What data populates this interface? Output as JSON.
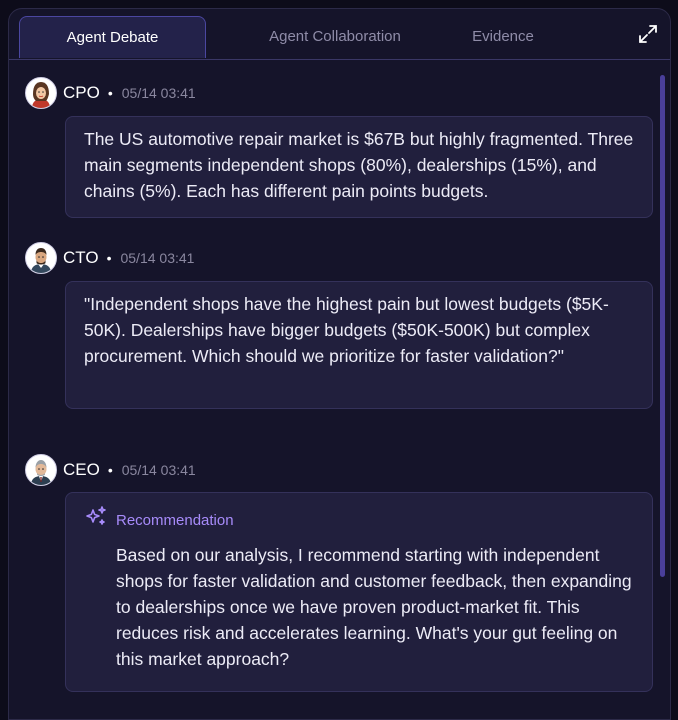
{
  "tabs": [
    {
      "label": "Agent Debate",
      "active": true
    },
    {
      "label": "Agent Collaboration",
      "active": false
    },
    {
      "label": "Evidence",
      "active": false
    }
  ],
  "icons": {
    "expand": "expand-icon",
    "sparkle": "sparkle-icon"
  },
  "colors": {
    "accent": "#a78bfa",
    "panel": "#15142a",
    "bubble": "#211f3d"
  },
  "messages": [
    {
      "author": "CPO",
      "separator": "•",
      "time": "05/14 03:41",
      "text": "The US automotive repair market is $67B but highly fragmented. Three main segments independent shops (80%), dealerships (15%), and chains (5%). Each has different pain points budgets."
    },
    {
      "author": "CTO",
      "separator": "•",
      "time": "05/14 03:41",
      "text": "\"Independent shops have the highest pain but lowest budgets ($5K-50K). Dealerships have bigger budgets ($50K-500K) but complex procurement. Which should we prioritize for faster validation?\""
    },
    {
      "author": "CEO",
      "separator": "•",
      "time": "05/14 03:41",
      "recommendation_label": "Recommendation",
      "text": "Based on our analysis, I recommend starting with independent shops for faster validation and customer feedback, then expanding to dealerships once we have proven product-market fit. This reduces risk and accelerates learning. What's your gut feeling on this market approach?"
    }
  ]
}
